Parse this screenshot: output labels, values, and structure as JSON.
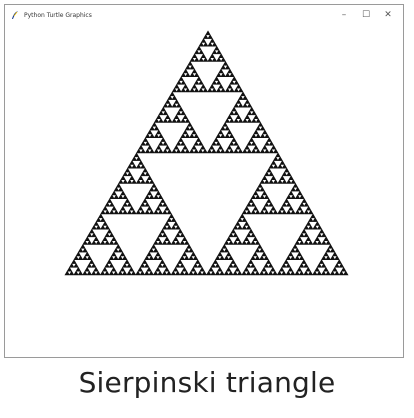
{
  "window": {
    "title": "Python Turtle Graphics",
    "controls": {
      "minimize": "–",
      "maximize": "☐",
      "close": "✕"
    },
    "app_icon": "turtle-feather-icon"
  },
  "canvas": {
    "drawing": "sierpinski-triangle",
    "recursion_depth": 6,
    "fill_color": "#111111",
    "background_color": "#ffffff"
  },
  "caption": {
    "text": "Sierpinski triangle"
  }
}
